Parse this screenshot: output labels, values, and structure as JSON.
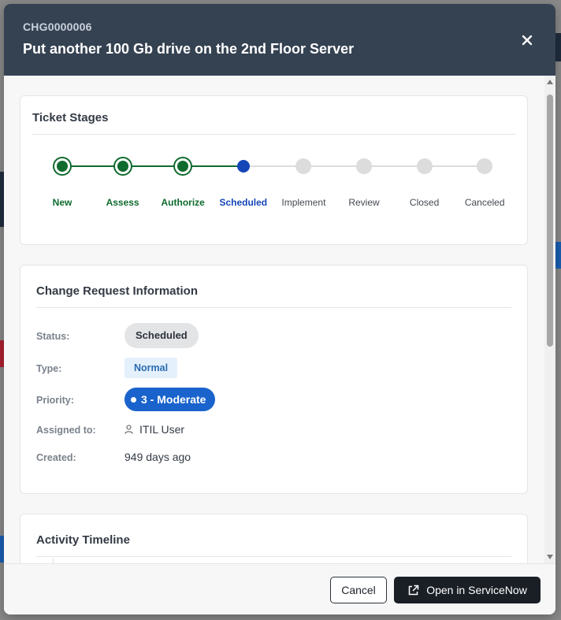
{
  "header": {
    "ticket_number": "CHG0000006",
    "title": "Put another 100 Gb drive on the 2nd Floor Server"
  },
  "stages_card": {
    "title": "Ticket Stages",
    "stages": [
      {
        "label": "New",
        "state": "complete"
      },
      {
        "label": "Assess",
        "state": "complete"
      },
      {
        "label": "Authorize",
        "state": "complete"
      },
      {
        "label": "Scheduled",
        "state": "current"
      },
      {
        "label": "Implement",
        "state": "pending"
      },
      {
        "label": "Review",
        "state": "pending"
      },
      {
        "label": "Closed",
        "state": "pending"
      },
      {
        "label": "Canceled",
        "state": "pending"
      }
    ],
    "colors": {
      "complete": "#0f6b2e",
      "current": "#1546b8",
      "pending": "#dcdcdc"
    }
  },
  "info_card": {
    "title": "Change Request Information",
    "status_label": "Status:",
    "status_value": "Scheduled",
    "type_label": "Type:",
    "type_value": "Normal",
    "priority_label": "Priority:",
    "priority_value": "3 - Moderate",
    "assigned_label": "Assigned to:",
    "assigned_value": "ITIL User",
    "created_label": "Created:",
    "created_value": "949 days ago"
  },
  "timeline_card": {
    "title": "Activity Timeline"
  },
  "footer": {
    "cancel_label": "Cancel",
    "open_label": "Open in ServiceNow"
  }
}
